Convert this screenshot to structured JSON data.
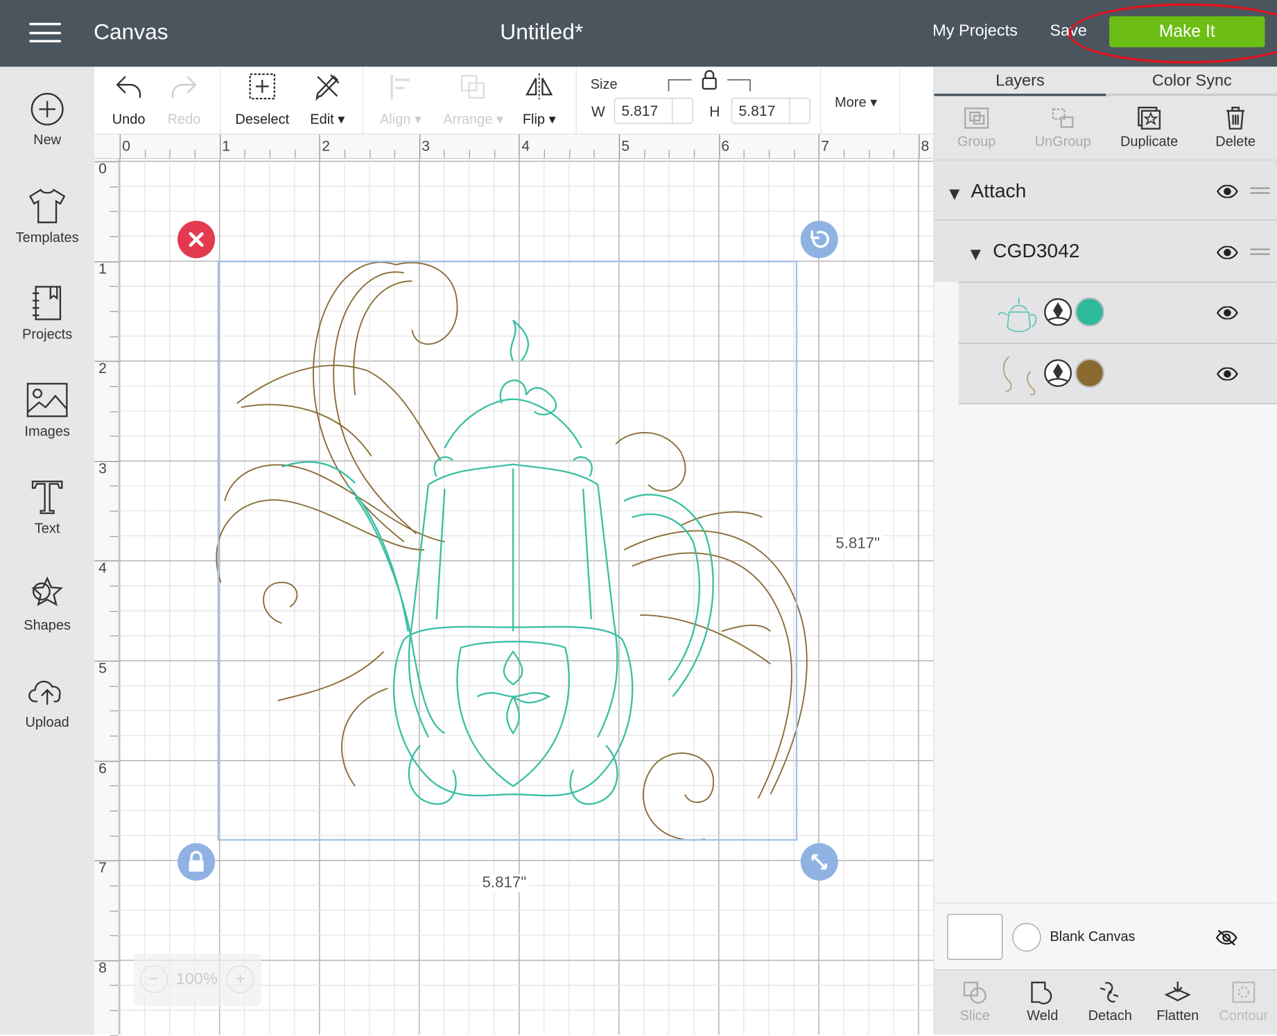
{
  "header": {
    "menu_icon": "hamburger-icon",
    "app_name": "Canvas",
    "project_title": "Untitled*",
    "my_projects": "My Projects",
    "save": "Save",
    "make_it": "Make It",
    "make_it_color": "#6cbd14"
  },
  "sidebar": {
    "items": [
      {
        "label": "New",
        "icon": "plus-circle-icon"
      },
      {
        "label": "Templates",
        "icon": "tshirt-icon"
      },
      {
        "label": "Projects",
        "icon": "notebook-icon"
      },
      {
        "label": "Images",
        "icon": "image-icon"
      },
      {
        "label": "Text",
        "icon": "text-icon"
      },
      {
        "label": "Shapes",
        "icon": "shapes-icon"
      },
      {
        "label": "Upload",
        "icon": "cloud-upload-icon"
      }
    ]
  },
  "toolbar": {
    "undo": "Undo",
    "redo": "Redo",
    "deselect": "Deselect",
    "edit": "Edit",
    "align": "Align",
    "arrange": "Arrange",
    "flip": "Flip",
    "size_label": "Size",
    "w_label": "W",
    "w_value": "5.817",
    "h_label": "H",
    "h_value": "5.817",
    "more": "More"
  },
  "ruler": {
    "x": [
      "0",
      "1",
      "2",
      "3",
      "4",
      "5",
      "6",
      "7",
      "8"
    ],
    "y": [
      "0",
      "1",
      "2",
      "3",
      "4",
      "5",
      "6",
      "7",
      "8"
    ]
  },
  "canvas": {
    "width_dim": "5.817\"",
    "height_dim": "5.817\"",
    "zoom": "100%",
    "teal": "#3bbfa3",
    "brown": "#8a6b35"
  },
  "panel": {
    "tabs": [
      "Layers",
      "Color Sync"
    ],
    "tools": [
      "Group",
      "UnGroup",
      "Duplicate",
      "Delete"
    ],
    "layers": {
      "group": "Attach",
      "subgroup": "CGD3042",
      "items": [
        {
          "color": "#2dbb9b"
        },
        {
          "color": "#8a6a2f"
        }
      ]
    },
    "blank_canvas": "Blank Canvas",
    "bottom_tools": [
      "Slice",
      "Weld",
      "Detach",
      "Flatten",
      "Contour"
    ]
  }
}
